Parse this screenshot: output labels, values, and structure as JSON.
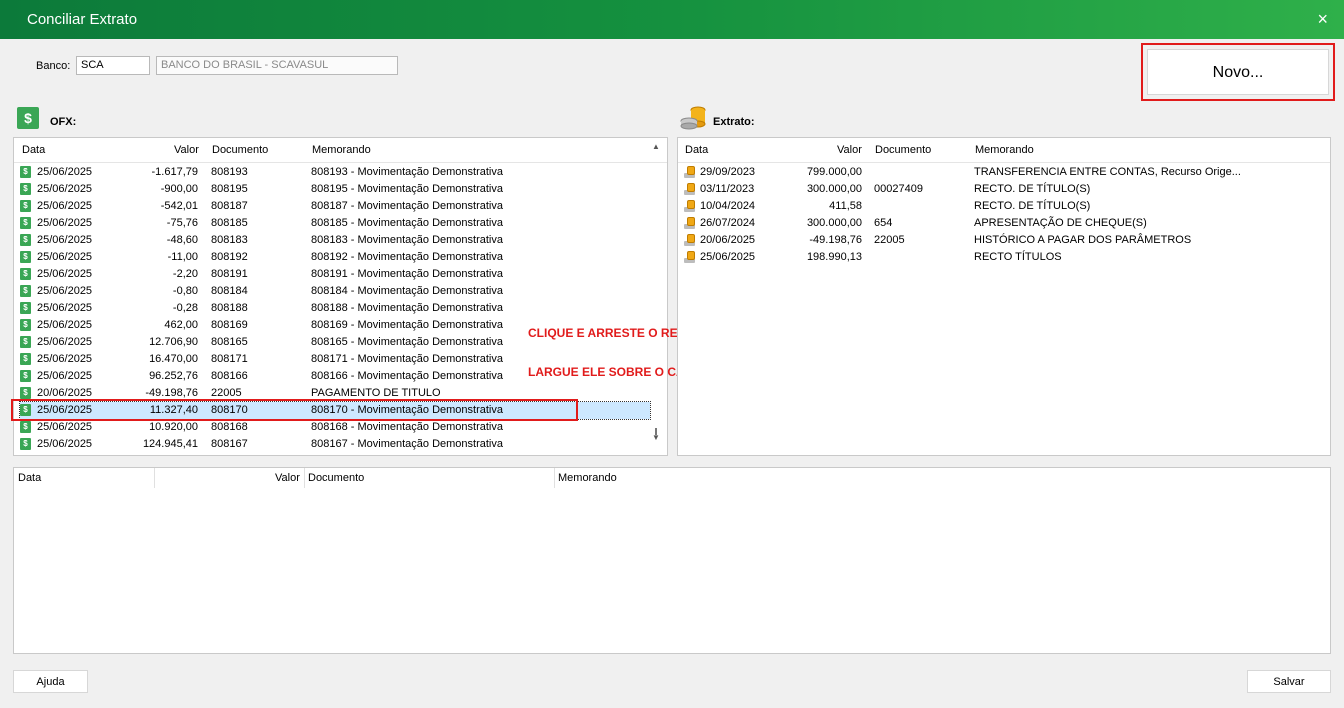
{
  "window": {
    "title": "Conciliar Extrato",
    "close_icon": "×"
  },
  "banco": {
    "label": "Banco:",
    "code": "SCA",
    "name": "BANCO DO BRASIL - SCAVASUL"
  },
  "novo_button": "Novo...",
  "ofx": {
    "label": "OFX:",
    "columns": [
      "Data",
      "Valor",
      "Documento",
      "Memorando"
    ],
    "rows": [
      {
        "data": "25/06/2025",
        "valor": "-1.617,79",
        "doc": "808193",
        "memo": "808193 - Movimentação Demonstrativa"
      },
      {
        "data": "25/06/2025",
        "valor": "-900,00",
        "doc": "808195",
        "memo": "808195 - Movimentação Demonstrativa"
      },
      {
        "data": "25/06/2025",
        "valor": "-542,01",
        "doc": "808187",
        "memo": "808187 - Movimentação Demonstrativa"
      },
      {
        "data": "25/06/2025",
        "valor": "-75,76",
        "doc": "808185",
        "memo": "808185 - Movimentação Demonstrativa"
      },
      {
        "data": "25/06/2025",
        "valor": "-48,60",
        "doc": "808183",
        "memo": "808183 - Movimentação Demonstrativa"
      },
      {
        "data": "25/06/2025",
        "valor": "-11,00",
        "doc": "808192",
        "memo": "808192 - Movimentação Demonstrativa"
      },
      {
        "data": "25/06/2025",
        "valor": "-2,20",
        "doc": "808191",
        "memo": "808191 - Movimentação Demonstrativa"
      },
      {
        "data": "25/06/2025",
        "valor": "-0,80",
        "doc": "808184",
        "memo": "808184 - Movimentação Demonstrativa"
      },
      {
        "data": "25/06/2025",
        "valor": "-0,28",
        "doc": "808188",
        "memo": "808188 - Movimentação Demonstrativa"
      },
      {
        "data": "25/06/2025",
        "valor": "462,00",
        "doc": "808169",
        "memo": "808169 - Movimentação Demonstrativa"
      },
      {
        "data": "25/06/2025",
        "valor": "12.706,90",
        "doc": "808165",
        "memo": "808165 - Movimentação Demonstrativa"
      },
      {
        "data": "25/06/2025",
        "valor": "16.470,00",
        "doc": "808171",
        "memo": "808171 - Movimentação Demonstrativa"
      },
      {
        "data": "25/06/2025",
        "valor": "96.252,76",
        "doc": "808166",
        "memo": "808166 - Movimentação Demonstrativa"
      },
      {
        "data": "20/06/2025",
        "valor": "-49.198,76",
        "doc": "22005",
        "memo": "PAGAMENTO DE TITULO"
      },
      {
        "data": "25/06/2025",
        "valor": "11.327,40",
        "doc": "808170",
        "memo": "808170 - Movimentação Demonstrativa",
        "selected": true
      },
      {
        "data": "25/06/2025",
        "valor": "10.920,00",
        "doc": "808168",
        "memo": "808168 - Movimentação Demonstrativa"
      },
      {
        "data": "25/06/2025",
        "valor": "124.945,41",
        "doc": "808167",
        "memo": "808167 - Movimentação Demonstrativa"
      }
    ]
  },
  "extrato": {
    "label": "Extrato:",
    "columns": [
      "Data",
      "Valor",
      "Documento",
      "Memorando"
    ],
    "rows": [
      {
        "data": "29/09/2023",
        "valor": "799.000,00",
        "doc": "",
        "memo": "TRANSFERENCIA ENTRE CONTAS, Recurso Orige..."
      },
      {
        "data": "03/11/2023",
        "valor": "300.000,00",
        "doc": "00027409",
        "memo": "RECTO. DE TÍTULO(S)"
      },
      {
        "data": "10/04/2024",
        "valor": "411,58",
        "doc": "",
        "memo": "RECTO. DE TÍTULO(S)"
      },
      {
        "data": "26/07/2024",
        "valor": "300.000,00",
        "doc": "654",
        "memo": "APRESENTAÇÃO DE CHEQUE(S)"
      },
      {
        "data": "20/06/2025",
        "valor": "-49.198,76",
        "doc": "22005",
        "memo": "HISTÓRICO A PAGAR DOS PARÂMETROS"
      },
      {
        "data": "25/06/2025",
        "valor": "198.990,13",
        "doc": "",
        "memo": "RECTO TÍTULOS"
      }
    ]
  },
  "bottom_table": {
    "columns": [
      "Data",
      "Valor",
      "Documento",
      "Memorando"
    ]
  },
  "instructions": [
    "CLIQUE E ARRESTE O REGISTRO.",
    "LARGUE ELE SOBRE O CAMPO \"NOVO\"."
  ],
  "footer": {
    "help": "Ajuda",
    "save": "Salvar"
  },
  "colors": {
    "accent": "#15913f",
    "annotation": "#e11b1b",
    "selection": "#cde8ff"
  }
}
